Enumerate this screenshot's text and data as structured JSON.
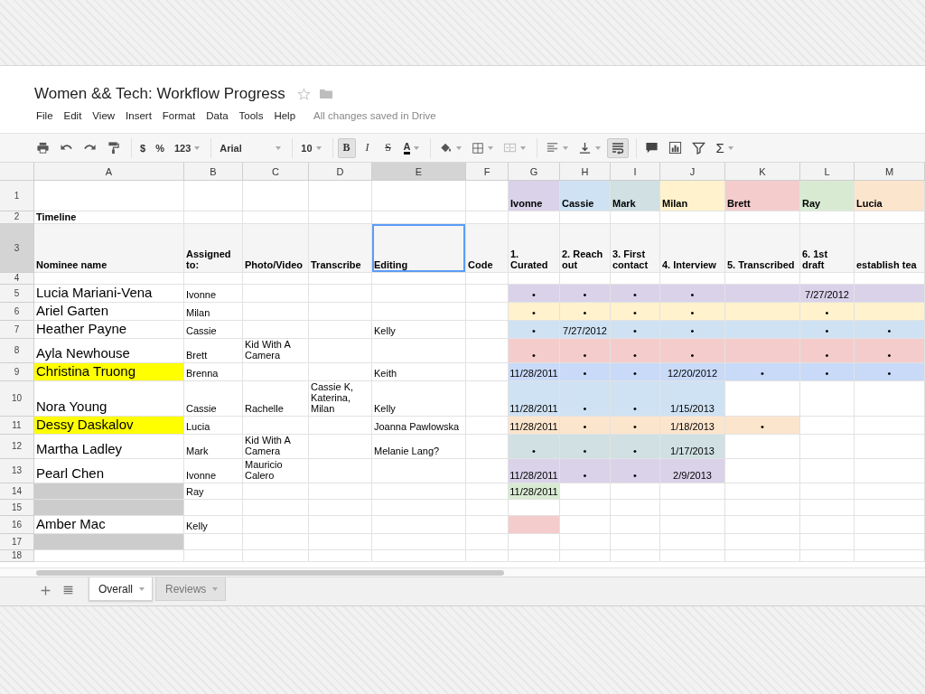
{
  "title": "Women && Tech: Workflow Progress",
  "menu": [
    "File",
    "Edit",
    "View",
    "Insert",
    "Format",
    "Data",
    "Tools",
    "Help"
  ],
  "save_status": "All changes saved in Drive",
  "toolbar": {
    "format_buttons": [
      {
        "label": "$"
      },
      {
        "label": "%"
      },
      {
        "label": "123"
      }
    ],
    "font": "Arial",
    "font_size": "10",
    "style_buttons": [
      {
        "label": "B",
        "on": true
      },
      {
        "label": "I",
        "on": false
      },
      {
        "label": "S",
        "on": false
      }
    ],
    "text_color": {
      "label": "A"
    },
    "wrap": {
      "on": true
    },
    "functions": {
      "label": "Σ"
    }
  },
  "sheet": {
    "columns": [
      {
        "label": "A",
        "selected": false
      },
      {
        "label": "B",
        "selected": false
      },
      {
        "label": "C",
        "selected": false
      },
      {
        "label": "D",
        "selected": false
      },
      {
        "label": "E",
        "selected": true
      },
      {
        "label": "F",
        "selected": false
      },
      {
        "label": "G",
        "selected": false
      },
      {
        "label": "H",
        "selected": false
      },
      {
        "label": "I",
        "selected": false
      },
      {
        "label": "J",
        "selected": false
      },
      {
        "label": "K",
        "selected": false
      },
      {
        "label": "L",
        "selected": false
      },
      {
        "label": "M",
        "selected": false
      }
    ],
    "rows": [
      {
        "number": "1",
        "kind": "people",
        "selected": false,
        "cells": [
          {},
          {},
          {},
          {},
          {},
          {},
          {
            "text": "Ivonne",
            "color": "#d9d2e9"
          },
          {
            "text": "Cassie",
            "color": "#cfe2f3"
          },
          {
            "text": "Mark",
            "color": "#d0e0e3"
          },
          {
            "text": "Milan",
            "color": "#fff2cc"
          },
          {
            "text": "Brett",
            "color": "#f4cccc"
          },
          {
            "text": "Ray",
            "color": "#d9ead3"
          },
          {
            "text": "Lucia",
            "color": "#fce5cd"
          }
        ]
      },
      {
        "number": "2",
        "kind": "section",
        "selected": false,
        "cells": [
          {
            "text": "Timeline"
          },
          {},
          {},
          {},
          {},
          {},
          {},
          {},
          {},
          {},
          {},
          {},
          {}
        ]
      },
      {
        "number": "3",
        "kind": "header",
        "selected": true,
        "cells": [
          {
            "text": "Nominee name"
          },
          {
            "text": "Assigned to:"
          },
          {
            "text": "Photo/Video"
          },
          {
            "text": "Transcribe"
          },
          {
            "text": "Editing"
          },
          {
            "text": "Code"
          },
          {
            "text": "1. Curated"
          },
          {
            "text": "2. Reach out"
          },
          {
            "text": "3. First contact"
          },
          {
            "text": "4. Interview"
          },
          {
            "text": "5. Transcribed"
          },
          {
            "text": "6. 1st draft"
          },
          {
            "text": "establish tea"
          }
        ]
      },
      {
        "number": "4",
        "kind": "blank",
        "selected": false,
        "cells": [
          {},
          {},
          {},
          {},
          {},
          {},
          {},
          {},
          {},
          {},
          {},
          {},
          {}
        ]
      },
      {
        "number": "5",
        "kind": "entry",
        "selected": false,
        "cells": [
          {
            "text": "Lucia Mariani-Vena"
          },
          {
            "text": "Ivonne"
          },
          {},
          {},
          {},
          {},
          {
            "text": "•",
            "color": "#d9d2e9"
          },
          {
            "text": "•",
            "color": "#d9d2e9"
          },
          {
            "text": "•",
            "color": "#d9d2e9"
          },
          {
            "text": "•",
            "color": "#d9d2e9"
          },
          {
            "color": "#d9d2e9"
          },
          {
            "text": "7/27/2012",
            "color": "#d9d2e9"
          },
          {
            "color": "#d9d2e9"
          }
        ]
      },
      {
        "number": "6",
        "kind": "entry",
        "selected": false,
        "cells": [
          {
            "text": "Ariel Garten"
          },
          {
            "text": "Milan"
          },
          {},
          {},
          {},
          {},
          {
            "text": "•",
            "color": "#fff2cc"
          },
          {
            "text": "•",
            "color": "#fff2cc"
          },
          {
            "text": "•",
            "color": "#fff2cc"
          },
          {
            "text": "•",
            "color": "#fff2cc"
          },
          {
            "color": "#fff2cc"
          },
          {
            "text": "•",
            "color": "#fff2cc"
          },
          {
            "color": "#fff2cc"
          }
        ]
      },
      {
        "number": "7",
        "kind": "entry",
        "selected": false,
        "cells": [
          {
            "text": "Heather Payne"
          },
          {
            "text": "Cassie"
          },
          {},
          {},
          {
            "text": "Kelly"
          },
          {},
          {
            "text": "•",
            "color": "#cfe2f3"
          },
          {
            "text": "7/27/2012",
            "color": "#cfe2f3"
          },
          {
            "text": "•",
            "color": "#cfe2f3"
          },
          {
            "text": "•",
            "color": "#cfe2f3"
          },
          {
            "color": "#cfe2f3"
          },
          {
            "text": "•",
            "color": "#cfe2f3"
          },
          {
            "text": "•",
            "color": "#cfe2f3"
          }
        ]
      },
      {
        "number": "8",
        "kind": "entry",
        "selected": false,
        "cells": [
          {
            "text": "Ayla Newhouse"
          },
          {
            "text": "Brett"
          },
          {
            "text": "Kid With A Camera"
          },
          {},
          {},
          {},
          {
            "text": "•",
            "color": "#f4cccc"
          },
          {
            "text": "•",
            "color": "#f4cccc"
          },
          {
            "text": "•",
            "color": "#f4cccc"
          },
          {
            "text": "•",
            "color": "#f4cccc"
          },
          {
            "color": "#f4cccc"
          },
          {
            "text": "•",
            "color": "#f4cccc"
          },
          {
            "text": "•",
            "color": "#f4cccc"
          }
        ]
      },
      {
        "number": "9",
        "kind": "entry",
        "selected": false,
        "cells": [
          {
            "text": "Christina Truong",
            "color": "#ffff00"
          },
          {
            "text": "Brenna"
          },
          {},
          {},
          {
            "text": "Keith"
          },
          {},
          {
            "text": "11/28/2011",
            "color": "#c9daf8"
          },
          {
            "text": "•",
            "color": "#c9daf8"
          },
          {
            "text": "•",
            "color": "#c9daf8"
          },
          {
            "text": "12/20/2012",
            "color": "#c9daf8"
          },
          {
            "text": "•",
            "color": "#c9daf8"
          },
          {
            "text": "•",
            "color": "#c9daf8"
          },
          {
            "text": "•",
            "color": "#c9daf8"
          }
        ]
      },
      {
        "number": "10",
        "kind": "entry",
        "selected": false,
        "cells": [
          {
            "text": "Nora Young"
          },
          {
            "text": "Cassie"
          },
          {
            "text": "Rachelle"
          },
          {
            "text": "Cassie K, Katerina, Milan"
          },
          {
            "text": "Kelly"
          },
          {},
          {
            "text": "11/28/2011",
            "color": "#cfe2f3"
          },
          {
            "text": "•",
            "color": "#cfe2f3"
          },
          {
            "text": "•",
            "color": "#cfe2f3"
          },
          {
            "text": "1/15/2013",
            "color": "#cfe2f3"
          },
          {},
          {},
          {}
        ]
      },
      {
        "number": "11",
        "kind": "entry",
        "selected": false,
        "cells": [
          {
            "text": "Dessy Daskalov",
            "color": "#ffff00"
          },
          {
            "text": "Lucia"
          },
          {},
          {},
          {
            "text": "Joanna Pawlowska"
          },
          {},
          {
            "text": "11/28/2011",
            "color": "#fce5cd"
          },
          {
            "text": "•",
            "color": "#fce5cd"
          },
          {
            "text": "•",
            "color": "#fce5cd"
          },
          {
            "text": "1/18/2013",
            "color": "#fce5cd"
          },
          {
            "text": "•",
            "color": "#fce5cd"
          },
          {},
          {}
        ]
      },
      {
        "number": "12",
        "kind": "entry",
        "selected": false,
        "cells": [
          {
            "text": "Martha Ladley"
          },
          {
            "text": "Mark"
          },
          {
            "text": "Kid With A Camera"
          },
          {},
          {
            "text": "Melanie Lang?"
          },
          {},
          {
            "text": "•",
            "color": "#d0e0e3"
          },
          {
            "text": "•",
            "color": "#d0e0e3"
          },
          {
            "text": "•",
            "color": "#d0e0e3"
          },
          {
            "text": "1/17/2013",
            "color": "#d0e0e3"
          },
          {},
          {},
          {}
        ]
      },
      {
        "number": "13",
        "kind": "entry",
        "selected": false,
        "cells": [
          {
            "text": "Pearl Chen"
          },
          {
            "text": "Ivonne"
          },
          {
            "text": "Mauricio Calero"
          },
          {},
          {},
          {},
          {
            "text": "11/28/2011",
            "color": "#d9d2e9"
          },
          {
            "text": "•",
            "color": "#d9d2e9"
          },
          {
            "text": "•",
            "color": "#d9d2e9"
          },
          {
            "text": "2/9/2013",
            "color": "#d9d2e9"
          },
          {},
          {},
          {}
        ]
      },
      {
        "number": "14",
        "kind": "entry",
        "selected": false,
        "cells": [
          {
            "color": "#cccccc"
          },
          {
            "text": "Ray"
          },
          {},
          {},
          {},
          {},
          {
            "text": "11/28/2011",
            "color": "#d9ead3"
          },
          {},
          {},
          {},
          {},
          {},
          {}
        ]
      },
      {
        "number": "15",
        "kind": "entry",
        "selected": false,
        "cells": [
          {
            "color": "#cccccc"
          },
          {},
          {},
          {},
          {},
          {},
          {},
          {},
          {},
          {},
          {},
          {},
          {}
        ]
      },
      {
        "number": "16",
        "kind": "entry",
        "selected": false,
        "cells": [
          {
            "text": "Amber Mac"
          },
          {
            "text": "Kelly"
          },
          {},
          {},
          {},
          {},
          {
            "color": "#f4cccc"
          },
          {},
          {},
          {},
          {},
          {},
          {}
        ]
      },
      {
        "number": "17",
        "kind": "entry",
        "selected": false,
        "cells": [
          {
            "color": "#cccccc"
          },
          {},
          {},
          {},
          {},
          {},
          {},
          {},
          {},
          {},
          {},
          {},
          {}
        ]
      },
      {
        "number": "18",
        "kind": "blank",
        "selected": false,
        "cells": [
          {},
          {},
          {},
          {},
          {},
          {},
          {},
          {},
          {},
          {},
          {},
          {},
          {}
        ]
      }
    ]
  },
  "sheet_tabs": [
    {
      "label": "Overall",
      "selected": true
    },
    {
      "label": "Reviews",
      "selected": false
    }
  ]
}
